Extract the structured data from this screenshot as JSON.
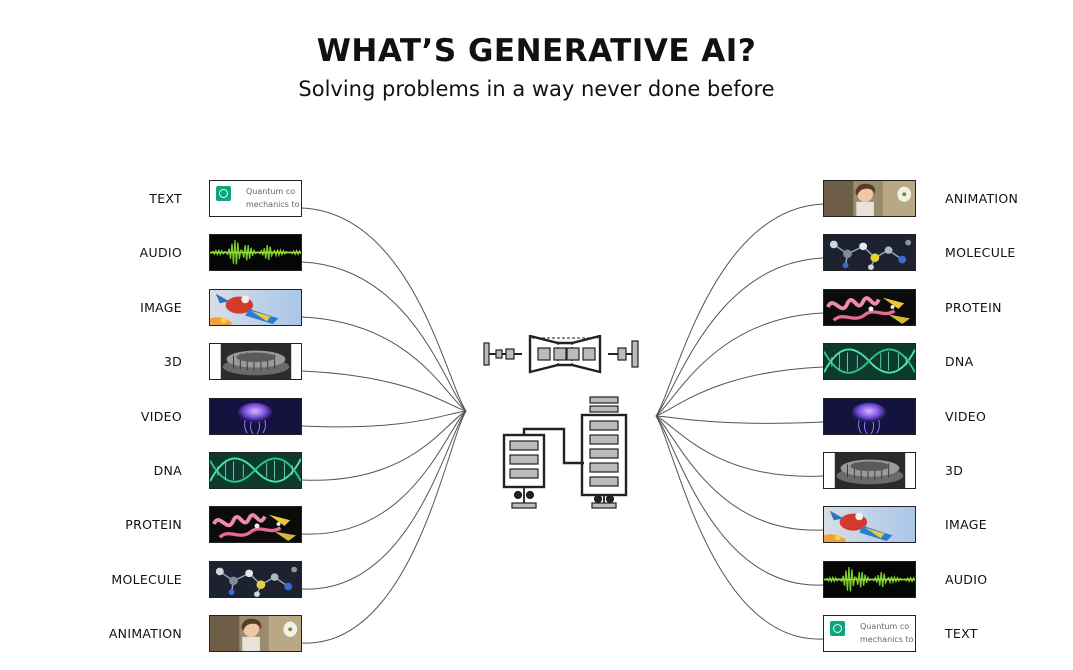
{
  "title": "WHAT’S GENERATIVE AI?",
  "subtitle": "Solving problems in a way never done before",
  "text_thumbnail": {
    "line1": "Quantum co",
    "line2": "mechanics to"
  },
  "inputs": [
    {
      "label": "TEXT",
      "thumb": "text"
    },
    {
      "label": "AUDIO",
      "thumb": "audio"
    },
    {
      "label": "IMAGE",
      "thumb": "image"
    },
    {
      "label": "3D",
      "thumb": "3d"
    },
    {
      "label": "VIDEO",
      "thumb": "video"
    },
    {
      "label": "DNA",
      "thumb": "dna"
    },
    {
      "label": "PROTEIN",
      "thumb": "protein"
    },
    {
      "label": "MOLECULE",
      "thumb": "molecule"
    },
    {
      "label": "ANIMATION",
      "thumb": "animation"
    }
  ],
  "outputs": [
    {
      "label": "ANIMATION",
      "thumb": "animation"
    },
    {
      "label": "MOLECULE",
      "thumb": "molecule"
    },
    {
      "label": "PROTEIN",
      "thumb": "protein"
    },
    {
      "label": "DNA",
      "thumb": "dna"
    },
    {
      "label": "VIDEO",
      "thumb": "video"
    },
    {
      "label": "3D",
      "thumb": "3d"
    },
    {
      "label": "IMAGE",
      "thumb": "image"
    },
    {
      "label": "AUDIO",
      "thumb": "audio"
    },
    {
      "label": "TEXT",
      "thumb": "text"
    }
  ]
}
